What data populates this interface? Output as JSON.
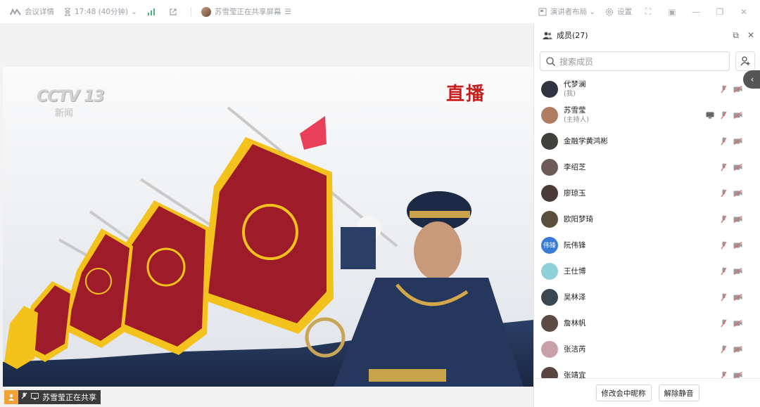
{
  "topbar": {
    "meeting_info": "会议详情",
    "time": "17:48 (40分钟)",
    "sharing": "苏雪莹正在共享屏幕",
    "layout": "演讲者布局",
    "settings": "设置"
  },
  "video": {
    "channel_logo": "CCTV 13",
    "channel_sub": "新闻",
    "live_badge": "直播"
  },
  "share_bar": {
    "text": "苏雪莹正在共享"
  },
  "panel": {
    "title": "成员(27)",
    "search_placeholder": "搜索成员",
    "members": [
      {
        "name": "代梦澜",
        "role": "(我)",
        "avatar_color": "#2f3440",
        "avatar_text": "",
        "screen_share": false
      },
      {
        "name": "苏雪莹",
        "role": "(主持人)",
        "avatar_color": "#b07c62",
        "avatar_text": "",
        "screen_share": true
      },
      {
        "name": "金融学黄鸿彬",
        "role": "",
        "avatar_color": "#40403c",
        "avatar_text": "",
        "screen_share": false
      },
      {
        "name": "李绍芝",
        "role": "",
        "avatar_color": "#6d5a58",
        "avatar_text": "",
        "screen_share": false
      },
      {
        "name": "廖琼玉",
        "role": "",
        "avatar_color": "#4a3a38",
        "avatar_text": "",
        "screen_share": false
      },
      {
        "name": "欧阳梦琦",
        "role": "",
        "avatar_color": "#5a4f3a",
        "avatar_text": "",
        "screen_share": false
      },
      {
        "name": "阮伟锋",
        "role": "",
        "avatar_color": "#3a7bd5",
        "avatar_text": "伟锋",
        "screen_share": false
      },
      {
        "name": "王仕博",
        "role": "",
        "avatar_color": "#8ed0d8",
        "avatar_text": "",
        "screen_share": false
      },
      {
        "name": "吴林泽",
        "role": "",
        "avatar_color": "#3a4750",
        "avatar_text": "",
        "screen_share": false
      },
      {
        "name": "詹林帆",
        "role": "",
        "avatar_color": "#5c4a44",
        "avatar_text": "",
        "screen_share": false
      },
      {
        "name": "张洁芮",
        "role": "",
        "avatar_color": "#c9a0a8",
        "avatar_text": "",
        "screen_share": false
      },
      {
        "name": "张靖宜",
        "role": "",
        "avatar_color": "#5a4440",
        "avatar_text": "",
        "screen_share": false
      }
    ],
    "rename_button": "修改会中昵称",
    "unmute_button": "解除静音"
  },
  "colors": {
    "mic_off": "#e06666",
    "share_accent": "#f0a13a"
  }
}
